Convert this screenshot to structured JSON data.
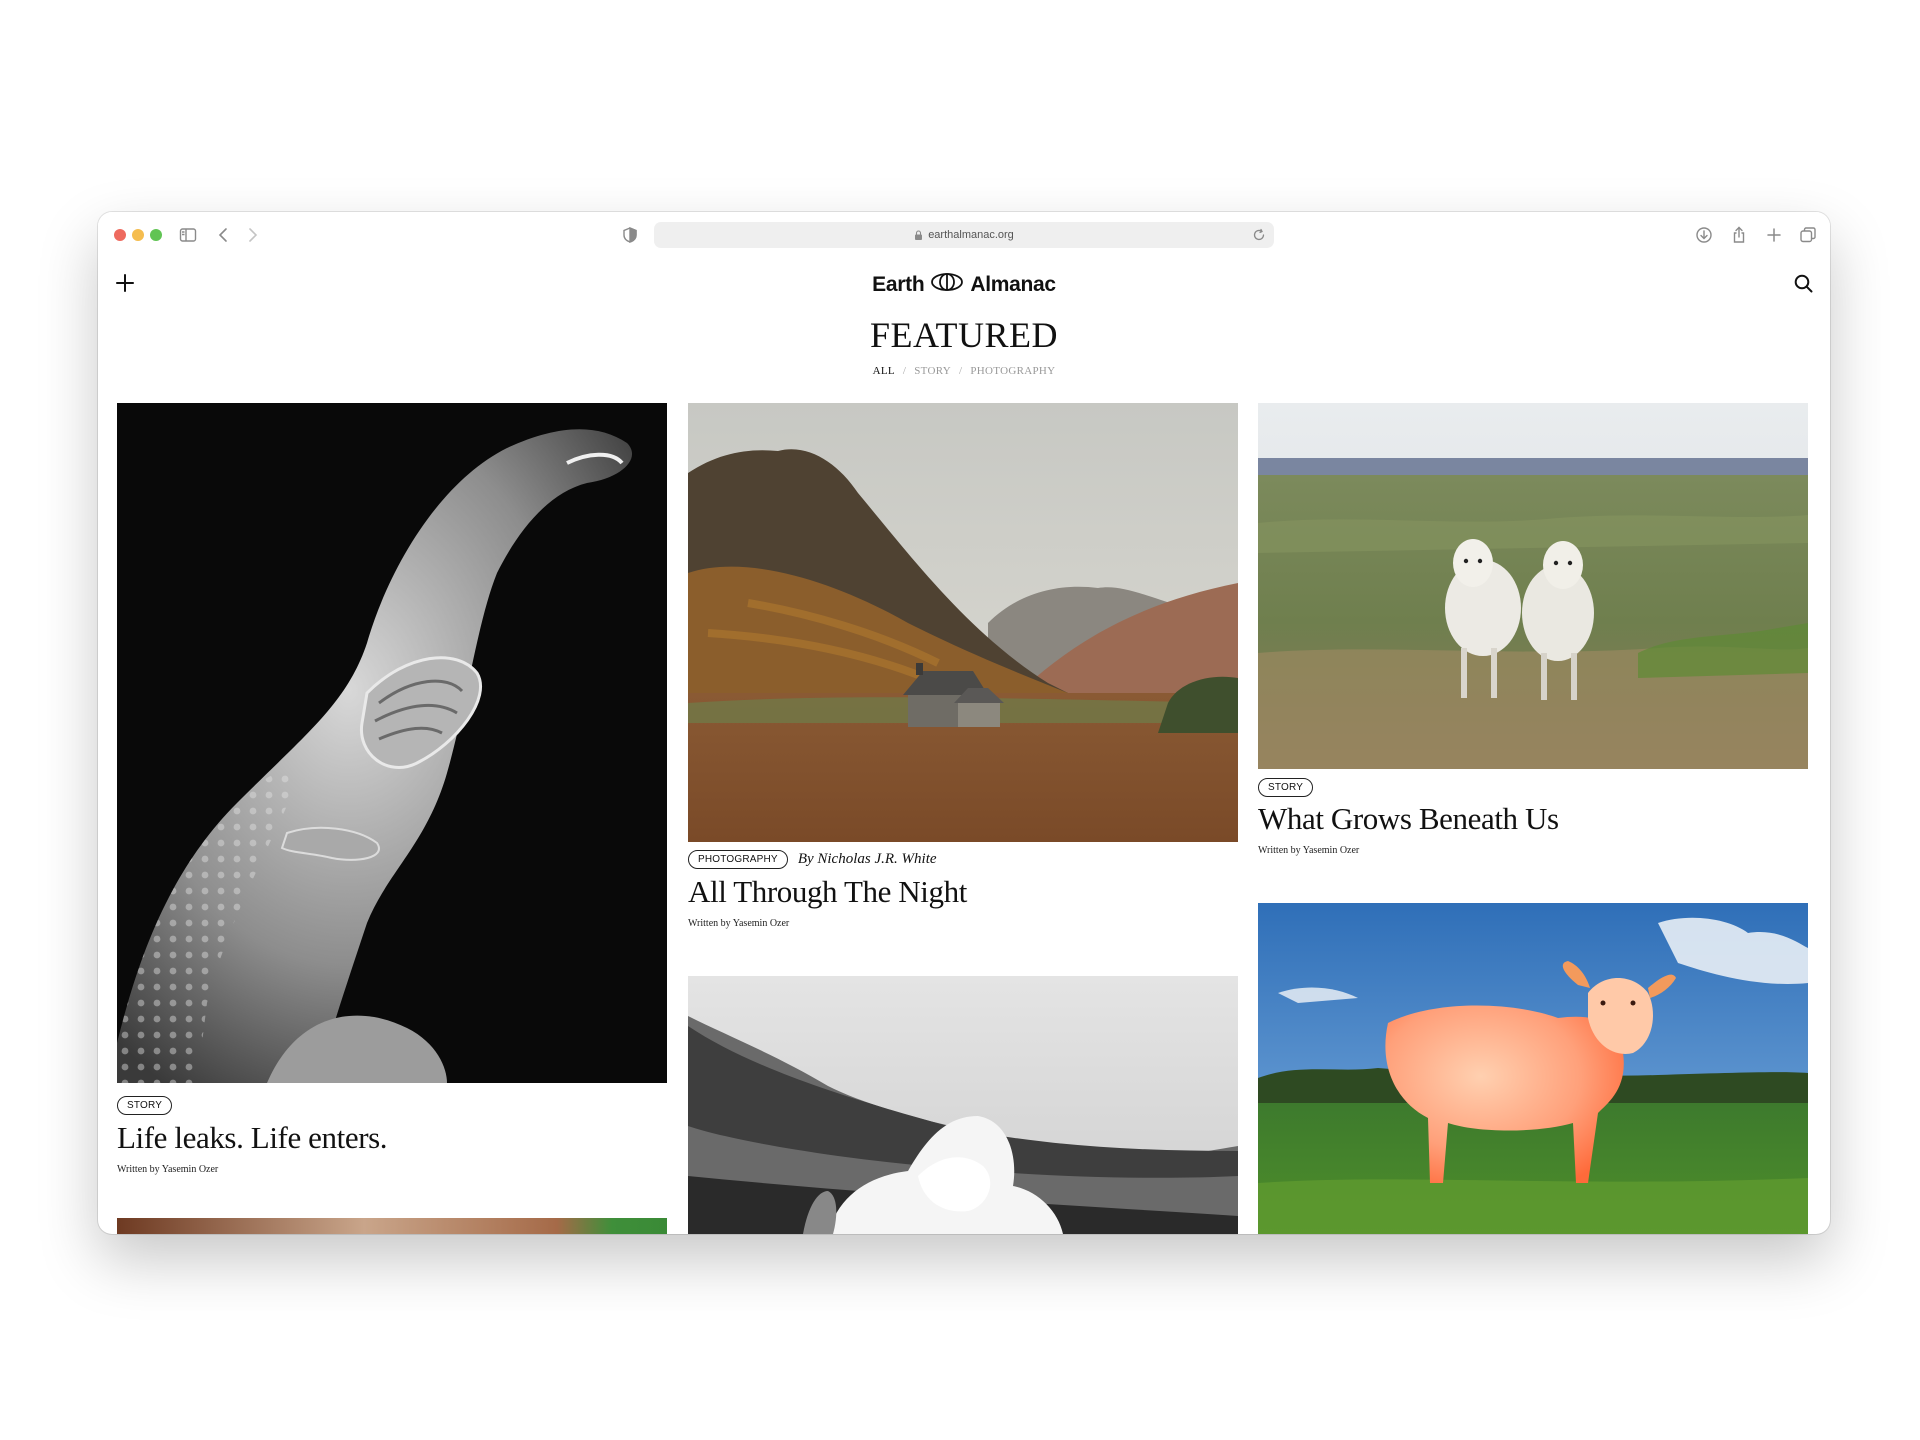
{
  "browser": {
    "url": "earthalmanac.org",
    "icons": {
      "sidebar": "sidebar-icon",
      "back": "chevron-left-icon",
      "forward": "chevron-right-icon",
      "privacy": "shield-icon",
      "lock": "lock-icon",
      "reload": "reload-icon",
      "download": "download-icon",
      "share": "share-icon",
      "new_tab": "plus-icon",
      "tabs": "tab-overview-icon"
    }
  },
  "site": {
    "logo_left": "Earth",
    "logo_right": "Almanac",
    "page_title": "FEATURED",
    "filters": {
      "all": "ALL",
      "story": "STORY",
      "photography": "PHOTOGRAPHY",
      "separator": "/"
    },
    "menu_icon": "plus-icon",
    "search_icon": "search-icon"
  },
  "cards": [
    {
      "image": "scanning-electron-micrograph-worm",
      "tag": "STORY",
      "title": "Life leaks. Life enters.",
      "author": "Written by Yasemin Ozer"
    },
    {
      "image": "highland-cottage-valley",
      "tag": "PHOTOGRAPHY",
      "byline": "By Nicholas J.R. White",
      "title": "All Through The Night",
      "author": "Written by Yasemin Ozer"
    },
    {
      "image": "two-sheep-in-field",
      "tag": "STORY",
      "title": "What Grows Beneath Us",
      "author": "Written by Yasemin Ozer"
    },
    {
      "image": "black-white-explosion-forest"
    },
    {
      "image": "orange-lit-cow-in-pasture"
    },
    {
      "image": "partial-animal-fur-photo"
    }
  ],
  "colors": {
    "background": "#ffffff",
    "text": "#111111",
    "muted_filter": "#999999",
    "traffic_red": "#ee6a5f",
    "traffic_yellow": "#f5bd4f",
    "traffic_green": "#61c454"
  }
}
